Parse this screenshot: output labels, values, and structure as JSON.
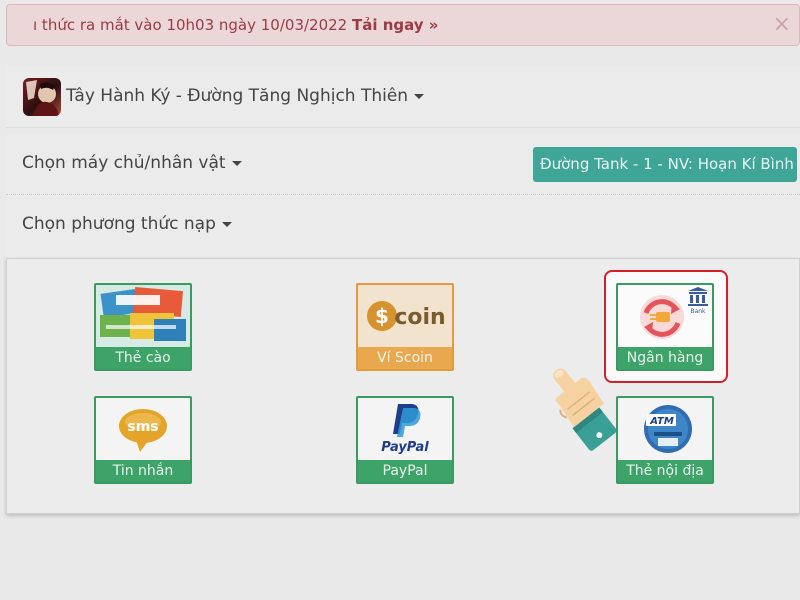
{
  "alert": {
    "text": "ı thức ra mắt vào 10h03 ngày 10/03/2022",
    "link": "Tải ngay »",
    "close": "×"
  },
  "game": {
    "title": "Tây Hành Ký - Đường Tăng Nghịch Thiên",
    "icon": "game-avatar-icon"
  },
  "server": {
    "label": "Chọn máy chủ/nhân vật",
    "selected": "Đường Tank - 1 - NV: Hoạn Kí Bình"
  },
  "payment": {
    "label": "Chọn phương thức nạp",
    "methods": [
      {
        "label": "Thẻ cào",
        "icon": "scratch-card-icon"
      },
      {
        "label": "Ví Scoin",
        "icon": "scoin-icon",
        "logo_text": "coin"
      },
      {
        "label": "Ngân hàng",
        "icon": "bank-transfer-icon",
        "logo_text": "Bank"
      },
      {
        "label": "Tin nhắn",
        "icon": "sms-icon",
        "logo_text": "sms"
      },
      {
        "label": "PayPal",
        "icon": "paypal-icon",
        "logo_text": "PayPal"
      },
      {
        "label": "Thẻ nội địa",
        "icon": "atm-icon",
        "logo_text": "ATM"
      }
    ]
  },
  "colors": {
    "accent": "#3fa597",
    "card_green": "#3ea369",
    "scoin_orange": "#eaa84e",
    "highlight_red": "#d31f2a"
  }
}
